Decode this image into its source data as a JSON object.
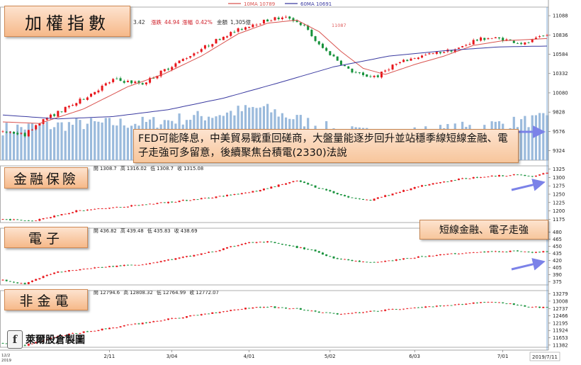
{
  "legend": {
    "ma10": "10MA 10789",
    "ma60": "60MA 10691",
    "ma10_color": "#d9534f",
    "ma60_color": "#3a3aa0"
  },
  "colors": {
    "up": "#e8161b",
    "down": "#15913a",
    "volume": "#8fb2d8",
    "arrow": "#7b82e8",
    "panel_line": "#888888"
  },
  "panels": {
    "main": {
      "title": "加權指數",
      "info": {
        "change_tail": "3.42",
        "change_label": "漲跌",
        "change": "44.94",
        "pct_label": "漲幅",
        "pct": "0.42%",
        "amount_label": "金額",
        "amount": "1,305億"
      },
      "peak_label": "11087",
      "note": "FED可能降息，中美貿易戰重回磋商，大盤量能逐步回升並站穩季線短線金融、電子走強可多留意，後續聚焦台積電(2330)法說"
    },
    "fin": {
      "title": "金融保險",
      "info": {
        "open_label": "開",
        "open": "1308.7",
        "high_label": "高",
        "high": "1316.02",
        "low_label": "低",
        "low": "1308.7",
        "close_label": "收",
        "close": "1315.08"
      }
    },
    "elec": {
      "title": "電子",
      "info": {
        "open_label": "開",
        "open": "436.82",
        "high_label": "高",
        "high": "439.48",
        "low_label": "低",
        "low": "435.83",
        "close_label": "收",
        "close": "438.69"
      },
      "note": "短線金融、電子走強"
    },
    "nonfin": {
      "title": "非金電",
      "info": {
        "open_label": "開",
        "open": "12794.6",
        "high_label": "高",
        "high": "12808.32",
        "low_label": "低",
        "low": "12764.99",
        "close_label": "收",
        "close": "12772.07"
      }
    }
  },
  "watermark": {
    "icon": "f",
    "text": "萊爾股倉製圖"
  },
  "date_badge": "2019/7/11",
  "x_left_label": [
    "2019",
    "12/2"
  ],
  "chart_data": [
    {
      "type": "candlestick",
      "title": "加權指數",
      "x_ticks": [
        "2/11",
        "3/04",
        "4/01",
        "5/02",
        "6/03",
        "7/01"
      ],
      "y_ticks": [
        11088,
        10836,
        10584,
        10332,
        10080,
        9828,
        9576,
        9324
      ],
      "ylim": [
        9200,
        11200
      ],
      "anchors": [
        [
          0,
          9580
        ],
        [
          6,
          9530
        ],
        [
          10,
          9700
        ],
        [
          20,
          9950
        ],
        [
          30,
          10250
        ],
        [
          38,
          10200
        ],
        [
          44,
          10380
        ],
        [
          52,
          10600
        ],
        [
          60,
          10820
        ],
        [
          68,
          10980
        ],
        [
          74,
          11050
        ],
        [
          78,
          11060
        ],
        [
          82,
          10950
        ],
        [
          86,
          10700
        ],
        [
          90,
          10550
        ],
        [
          94,
          10380
        ],
        [
          98,
          10300
        ],
        [
          102,
          10300
        ],
        [
          106,
          10440
        ],
        [
          112,
          10540
        ],
        [
          118,
          10600
        ],
        [
          124,
          10660
        ],
        [
          128,
          10760
        ],
        [
          132,
          10800
        ],
        [
          136,
          10780
        ],
        [
          142,
          10720
        ],
        [
          148,
          10836
        ]
      ],
      "series": [
        {
          "name": "10MA",
          "anchors": [
            [
              0,
              9700
            ],
            [
              10,
              9680
            ],
            [
              22,
              9870
            ],
            [
              34,
              10160
            ],
            [
              44,
              10330
            ],
            [
              54,
              10560
            ],
            [
              64,
              10850
            ],
            [
              72,
              10990
            ],
            [
              80,
              11030
            ],
            [
              86,
              10880
            ],
            [
              92,
              10620
            ],
            [
              98,
              10400
            ],
            [
              104,
              10320
            ],
            [
              112,
              10450
            ],
            [
              120,
              10560
            ],
            [
              128,
              10700
            ],
            [
              136,
              10760
            ],
            [
              148,
              10789
            ]
          ]
        },
        {
          "name": "60MA",
          "anchors": [
            [
              0,
              9790
            ],
            [
              15,
              9740
            ],
            [
              30,
              9770
            ],
            [
              45,
              9860
            ],
            [
              60,
              10010
            ],
            [
              75,
              10210
            ],
            [
              90,
              10420
            ],
            [
              105,
              10560
            ],
            [
              120,
              10630
            ],
            [
              135,
              10680
            ],
            [
              148,
              10691
            ]
          ]
        }
      ],
      "volume_anchors": [
        [
          0,
          0.42
        ],
        [
          20,
          0.48
        ],
        [
          40,
          0.5
        ],
        [
          60,
          0.62
        ],
        [
          70,
          0.7
        ],
        [
          80,
          0.55
        ],
        [
          90,
          0.4
        ],
        [
          100,
          0.35
        ],
        [
          110,
          0.36
        ],
        [
          120,
          0.4
        ],
        [
          135,
          0.48
        ],
        [
          148,
          0.55
        ]
      ]
    },
    {
      "type": "candlestick",
      "title": "金融保險",
      "y_ticks": [
        1325,
        1300,
        1275,
        1250,
        1225,
        1200,
        1175
      ],
      "ylim": [
        1165,
        1335
      ],
      "anchors": [
        [
          0,
          1175
        ],
        [
          8,
          1170
        ],
        [
          20,
          1200
        ],
        [
          35,
          1215
        ],
        [
          50,
          1232
        ],
        [
          60,
          1245
        ],
        [
          70,
          1262
        ],
        [
          76,
          1280
        ],
        [
          80,
          1290
        ],
        [
          84,
          1275
        ],
        [
          88,
          1262
        ],
        [
          94,
          1240
        ],
        [
          100,
          1232
        ],
        [
          106,
          1252
        ],
        [
          114,
          1275
        ],
        [
          122,
          1292
        ],
        [
          128,
          1300
        ],
        [
          134,
          1305
        ],
        [
          140,
          1308
        ],
        [
          144,
          1302
        ],
        [
          148,
          1315
        ]
      ]
    },
    {
      "type": "candlestick",
      "title": "電子",
      "y_ticks": [
        480,
        465,
        450,
        435,
        420,
        405,
        390,
        375
      ],
      "ylim": [
        368,
        488
      ],
      "anchors": [
        [
          0,
          378
        ],
        [
          6,
          370
        ],
        [
          14,
          395
        ],
        [
          26,
          405
        ],
        [
          38,
          412
        ],
        [
          48,
          425
        ],
        [
          58,
          440
        ],
        [
          66,
          457
        ],
        [
          72,
          459
        ],
        [
          78,
          450
        ],
        [
          84,
          442
        ],
        [
          90,
          425
        ],
        [
          96,
          418
        ],
        [
          100,
          415
        ],
        [
          108,
          422
        ],
        [
          116,
          430
        ],
        [
          124,
          435
        ],
        [
          132,
          438
        ],
        [
          140,
          440
        ],
        [
          144,
          436
        ],
        [
          148,
          439
        ]
      ]
    },
    {
      "type": "candlestick",
      "title": "非金電",
      "y_ticks": [
        13279,
        13008,
        12737,
        12466,
        12195,
        11924,
        11653,
        11382
      ],
      "ylim": [
        11300,
        13400
      ],
      "anchors": [
        [
          0,
          11450
        ],
        [
          6,
          11380
        ],
        [
          14,
          11700
        ],
        [
          26,
          11950
        ],
        [
          38,
          12200
        ],
        [
          48,
          12400
        ],
        [
          58,
          12600
        ],
        [
          66,
          12750
        ],
        [
          72,
          12800
        ],
        [
          80,
          12720
        ],
        [
          86,
          12600
        ],
        [
          92,
          12520
        ],
        [
          98,
          12600
        ],
        [
          106,
          12700
        ],
        [
          114,
          12780
        ],
        [
          122,
          12850
        ],
        [
          128,
          12950
        ],
        [
          132,
          12990
        ],
        [
          138,
          12900
        ],
        [
          144,
          12790
        ],
        [
          148,
          12772
        ]
      ]
    }
  ]
}
